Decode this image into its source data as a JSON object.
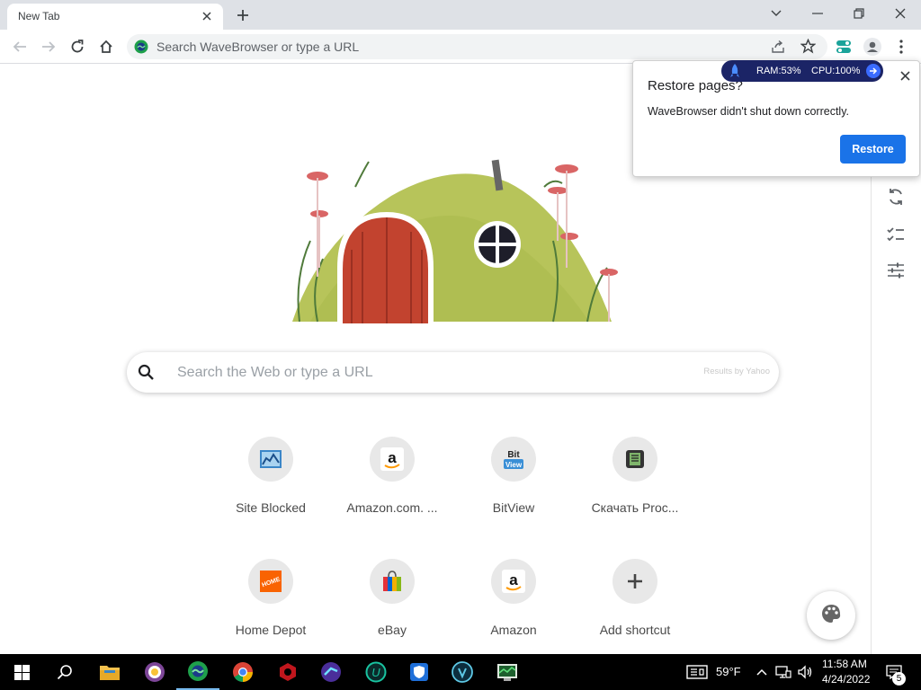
{
  "tabs": [
    {
      "title": "New Tab"
    }
  ],
  "toolbar": {
    "omnibox_placeholder": "Search WaveBrowser or type a URL"
  },
  "extension_pill": {
    "ram": "RAM:53%",
    "cpu": "CPU:100%"
  },
  "restore_popup": {
    "title": "Restore pages?",
    "message": "WaveBrowser didn't shut down correctly.",
    "button": "Restore"
  },
  "search": {
    "placeholder": "Search the Web or type a URL",
    "provider_note": "Results by Yahoo"
  },
  "shortcuts": [
    {
      "label": "Site Blocked",
      "icon": "site-blocked-icon"
    },
    {
      "label": "Amazon.com. ...",
      "icon": "amazon-icon"
    },
    {
      "label": "BitView",
      "icon": "bitview-icon"
    },
    {
      "label": "Скачать Proc...",
      "icon": "process-icon"
    },
    {
      "label": "Home Depot",
      "icon": "home-depot-icon"
    },
    {
      "label": "eBay",
      "icon": "ebay-icon"
    },
    {
      "label": "Amazon",
      "icon": "amazon-icon"
    },
    {
      "label": "Add shortcut",
      "icon": "plus-icon"
    }
  ],
  "taskbar": {
    "weather": "59°F",
    "time": "11:58 AM",
    "date": "4/24/2022",
    "notification_count": "5"
  },
  "colors": {
    "accent": "#1a73e8",
    "tabstrip": "#dee1e6",
    "pill": "#1b2466"
  }
}
